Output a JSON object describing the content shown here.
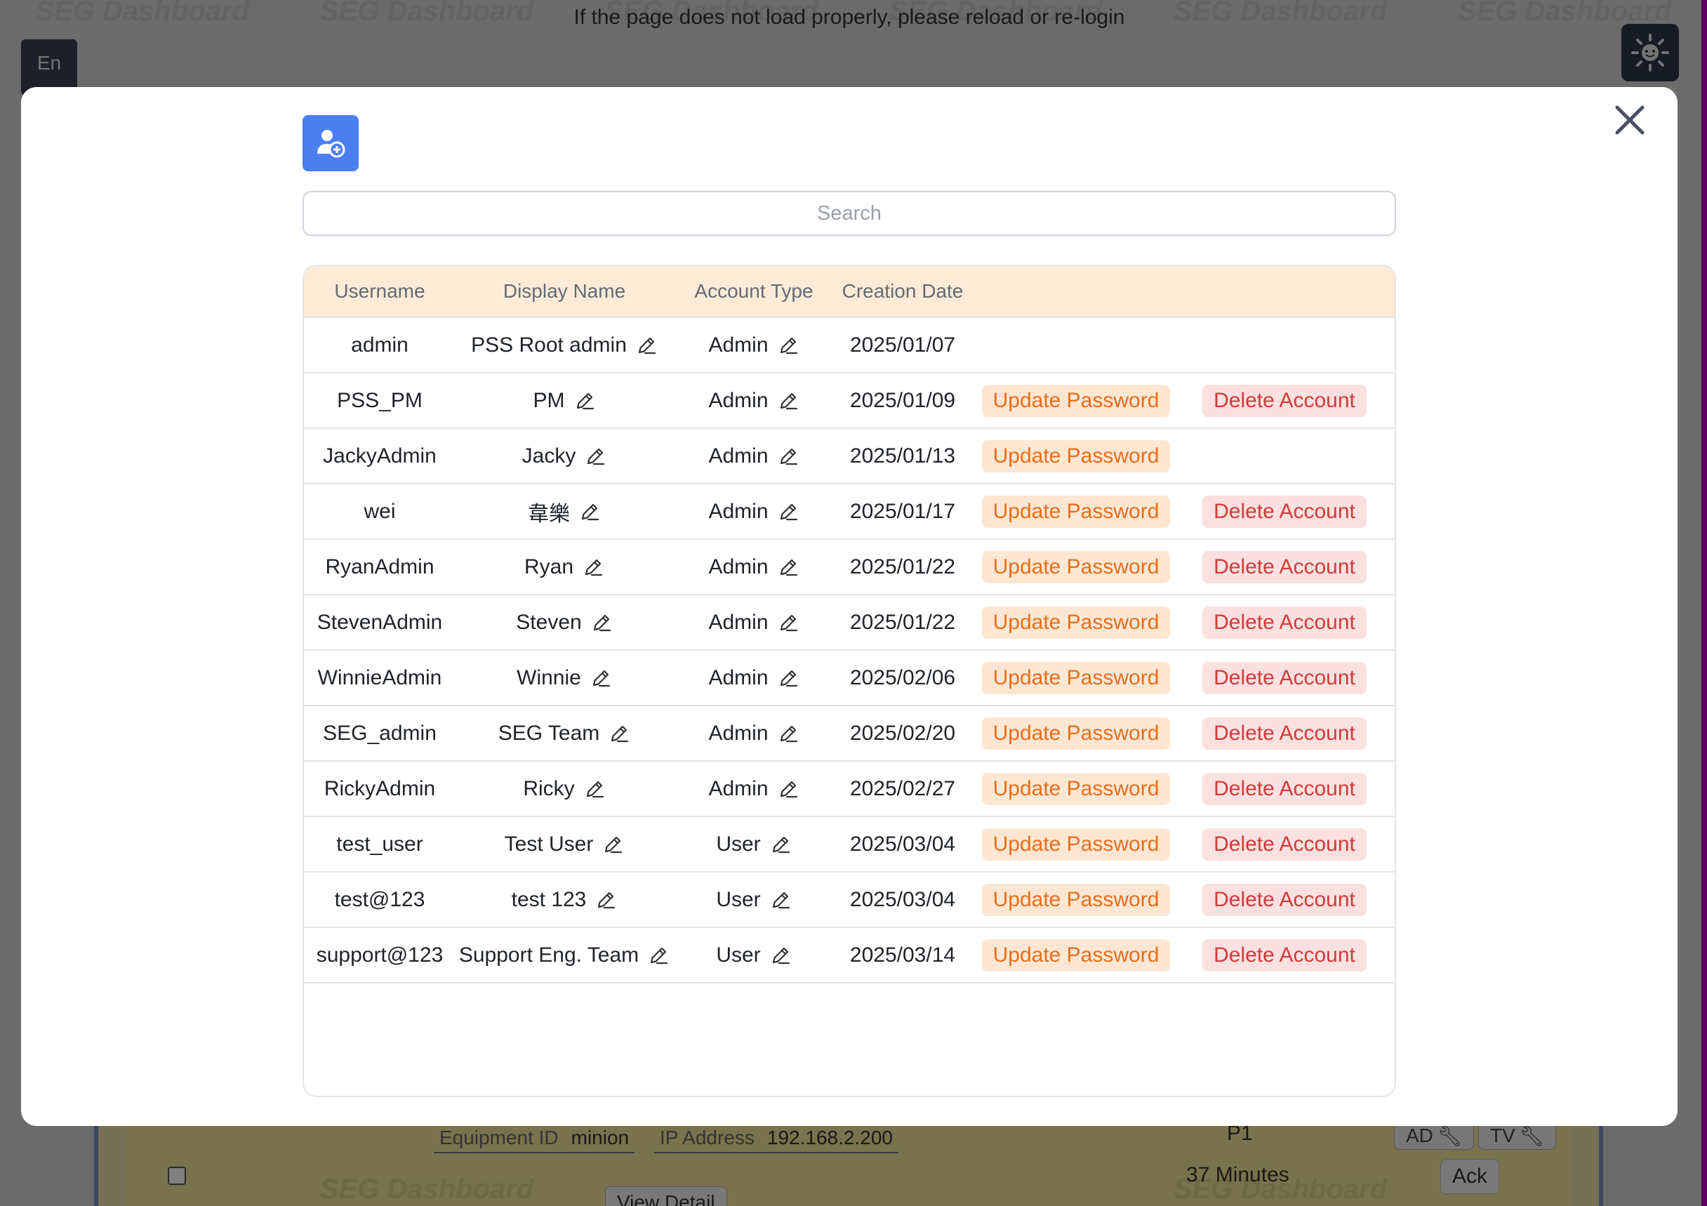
{
  "background": {
    "watermark": "SEG Dashboard",
    "reload_message": "If the page does not load properly, please reload or re-login",
    "language_button": "En",
    "alarm_card": {
      "equipment_id_label": "Equipment ID",
      "equipment_id_value": "minion",
      "ip_label": "IP Address",
      "ip_value": "192.168.2.200",
      "priority": "P1",
      "duration": "37 Minutes",
      "tag_ad": "AD",
      "tag_tv": "TV",
      "ack_label": "Ack",
      "view_detail_label": "View Detail"
    }
  },
  "modal": {
    "search_placeholder": "Search",
    "columns": {
      "username": "Username",
      "display_name": "Display Name",
      "account_type": "Account Type",
      "creation_date": "Creation Date"
    },
    "update_password_label": "Update Password",
    "delete_account_label": "Delete Account",
    "users": [
      {
        "username": "admin",
        "display_name": "PSS Root admin",
        "account_type": "Admin",
        "creation_date": "2025/01/07",
        "can_update": false,
        "can_delete": false
      },
      {
        "username": "PSS_PM",
        "display_name": "PM",
        "account_type": "Admin",
        "creation_date": "2025/01/09",
        "can_update": true,
        "can_delete": true
      },
      {
        "username": "JackyAdmin",
        "display_name": "Jacky",
        "account_type": "Admin",
        "creation_date": "2025/01/13",
        "can_update": true,
        "can_delete": false
      },
      {
        "username": "wei",
        "display_name": "韋樂",
        "account_type": "Admin",
        "creation_date": "2025/01/17",
        "can_update": true,
        "can_delete": true
      },
      {
        "username": "RyanAdmin",
        "display_name": "Ryan",
        "account_type": "Admin",
        "creation_date": "2025/01/22",
        "can_update": true,
        "can_delete": true
      },
      {
        "username": "StevenAdmin",
        "display_name": "Steven",
        "account_type": "Admin",
        "creation_date": "2025/01/22",
        "can_update": true,
        "can_delete": true
      },
      {
        "username": "WinnieAdmin",
        "display_name": "Winnie",
        "account_type": "Admin",
        "creation_date": "2025/02/06",
        "can_update": true,
        "can_delete": true
      },
      {
        "username": "SEG_admin",
        "display_name": "SEG Team",
        "account_type": "Admin",
        "creation_date": "2025/02/20",
        "can_update": true,
        "can_delete": true
      },
      {
        "username": "RickyAdmin",
        "display_name": "Ricky",
        "account_type": "Admin",
        "creation_date": "2025/02/27",
        "can_update": true,
        "can_delete": true
      },
      {
        "username": "test_user",
        "display_name": "Test User",
        "account_type": "User",
        "creation_date": "2025/03/04",
        "can_update": true,
        "can_delete": true
      },
      {
        "username": "test@123",
        "display_name": "test 123",
        "account_type": "User",
        "creation_date": "2025/03/04",
        "can_update": true,
        "can_delete": true
      },
      {
        "username": "support@123",
        "display_name": "Support Eng. Team",
        "account_type": "User",
        "creation_date": "2025/03/14",
        "can_update": true,
        "can_delete": true
      }
    ]
  },
  "icons": {
    "add_user": "add-user-icon",
    "close": "close-icon",
    "edit": "pencil-icon",
    "theme": "sun-icon"
  },
  "colors": {
    "primary": "#4b7ff0",
    "header_bg": "#fdebd7",
    "update_bg": "#fde7d2",
    "update_text": "#e86d1c",
    "delete_bg": "#fbe0e0",
    "delete_text": "#d23a3a"
  }
}
